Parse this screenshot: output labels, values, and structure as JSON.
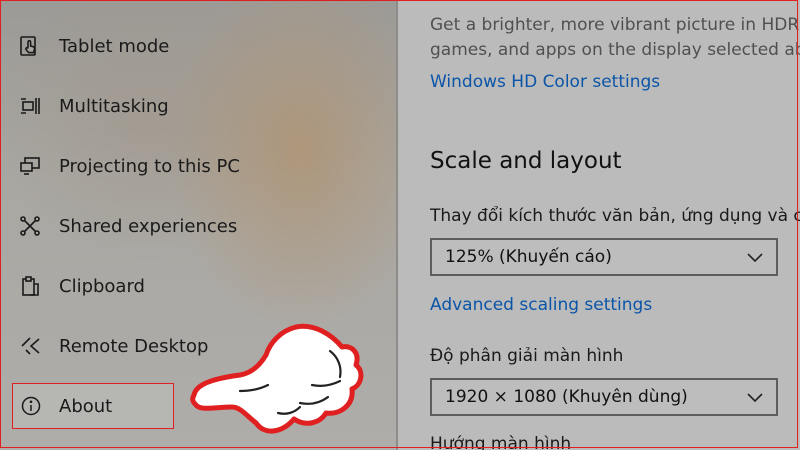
{
  "sidebar": {
    "items": [
      {
        "label": "Tablet mode",
        "icon": "tablet-mode-icon"
      },
      {
        "label": "Multitasking",
        "icon": "multitasking-icon"
      },
      {
        "label": "Projecting to this PC",
        "icon": "projecting-icon"
      },
      {
        "label": "Shared experiences",
        "icon": "shared-experiences-icon"
      },
      {
        "label": "Clipboard",
        "icon": "clipboard-icon"
      },
      {
        "label": "Remote Desktop",
        "icon": "remote-desktop-icon"
      },
      {
        "label": "About",
        "icon": "info-icon"
      }
    ]
  },
  "main": {
    "hdr_desc_line1": "Get a brighter, more vibrant picture in HDR a",
    "hdr_desc_line2": "games, and apps on the display selected abo",
    "hdr_link": "Windows HD Color settings",
    "scale_heading": "Scale and layout",
    "scale_label": "Thay đổi kích thước văn bản, ứng dụng và cá",
    "scale_value": "125% (Khuyến cáo)",
    "advanced_link": "Advanced scaling settings",
    "resolution_label": "Độ phân giải màn hình",
    "resolution_value": "1920 × 1080 (Khuyên dùng)",
    "orientation_label": "Hướng màn hình"
  },
  "colors": {
    "link": "#0a55a8",
    "highlight_border": "#e02020",
    "panel_bg": "#bbbbbb"
  }
}
